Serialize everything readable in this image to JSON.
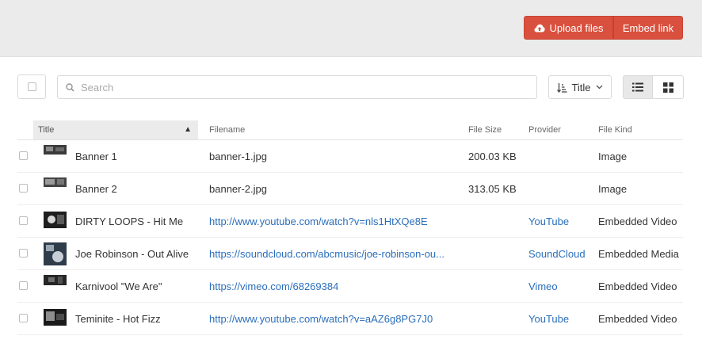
{
  "toolbar": {
    "upload_label": "Upload files",
    "embed_label": "Embed link",
    "search_placeholder": "Search",
    "sort_label": "Title"
  },
  "columns": {
    "title": "Title",
    "filename": "Filename",
    "size": "File Size",
    "provider": "Provider",
    "kind": "File Kind"
  },
  "colors": {
    "accent": "#d9503e",
    "link": "#2a6ebb"
  },
  "rows": [
    {
      "title": "Banner 1",
      "filename": "banner-1.jpg",
      "size": "200.03 KB",
      "provider": "",
      "kind": "Image",
      "filename_is_link": false
    },
    {
      "title": "Banner 2",
      "filename": "banner-2.jpg",
      "size": "313.05 KB",
      "provider": "",
      "kind": "Image",
      "filename_is_link": false
    },
    {
      "title": "DIRTY LOOPS - Hit Me",
      "filename": "http://www.youtube.com/watch?v=nls1HtXQe8E",
      "size": "",
      "provider": "YouTube",
      "kind": "Embedded Video",
      "filename_is_link": true
    },
    {
      "title": "Joe Robinson - Out Alive",
      "filename": "https://soundcloud.com/abcmusic/joe-robinson-ou...",
      "size": "",
      "provider": "SoundCloud",
      "kind": "Embedded Media",
      "filename_is_link": true
    },
    {
      "title": "Karnivool \"We Are\"",
      "filename": "https://vimeo.com/68269384",
      "size": "",
      "provider": "Vimeo",
      "kind": "Embedded Video",
      "filename_is_link": true
    },
    {
      "title": "Teminite - Hot Fizz",
      "filename": "http://www.youtube.com/watch?v=aAZ6g8PG7J0",
      "size": "",
      "provider": "YouTube",
      "kind": "Embedded Video",
      "filename_is_link": true
    }
  ]
}
